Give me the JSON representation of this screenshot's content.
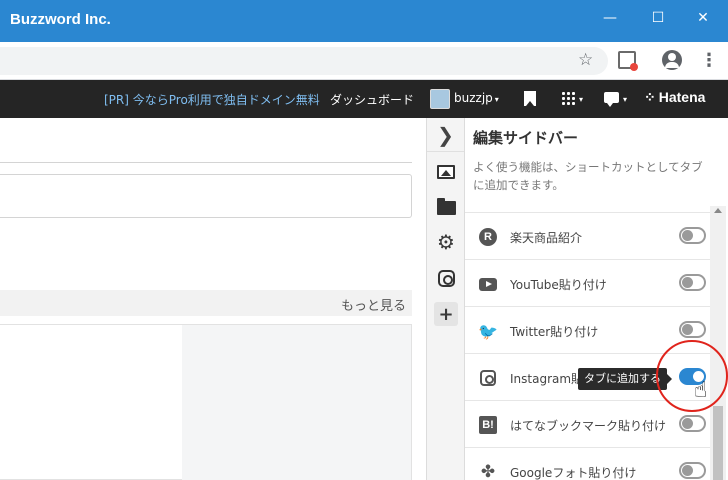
{
  "window": {
    "title": "Buzzword Inc.",
    "minimize_glyph": "—",
    "maximize_glyph": "☐",
    "close_glyph": "✕"
  },
  "browser": {
    "star_glyph": "☆",
    "menu_glyph": "⋮"
  },
  "header": {
    "promo_text": "[PR] 今ならPro利用で独自ドメイン無料",
    "dashboard_label": "ダッシュボード",
    "username": "buzzjp",
    "logo_text": "Hatena",
    "logo_mark": "⁘",
    "caret_glyph": "▾"
  },
  "editor": {
    "more_link": "もっと見る"
  },
  "icon_column": {
    "toggle_glyph": "❯",
    "gear_glyph": "⚙",
    "plus_glyph": "+"
  },
  "panel": {
    "title": "編集サイドバー",
    "description": "よく使う機能は、ショートカットとしてタブに追加できます。",
    "items": [
      {
        "label": "楽天商品紹介",
        "icon": "rakuten-icon",
        "glyph": "R",
        "enabled": false
      },
      {
        "label": "YouTube貼り付け",
        "icon": "youtube-icon",
        "glyph": "",
        "enabled": false
      },
      {
        "label": "Twitter貼り付け",
        "icon": "twitter-icon",
        "glyph": "🐦",
        "enabled": false
      },
      {
        "label": "Instagram貼り付け",
        "icon": "instagram-icon",
        "glyph": "",
        "enabled": true
      },
      {
        "label": "はてなブックマーク貼り付け",
        "icon": "hatena-bookmark-icon",
        "glyph": "B!",
        "enabled": false
      },
      {
        "label": "Googleフォト貼り付け",
        "icon": "google-photos-icon",
        "glyph": "✤",
        "enabled": false
      }
    ]
  },
  "tooltip": {
    "text": "タブに追加する"
  },
  "cursor_glyph": "☝",
  "colors": {
    "titlebar": "#2b87d1",
    "header_bg": "#252525",
    "promo": "#7fbdf0",
    "switch_on": "#2b87d1",
    "highlight": "#e0241c"
  }
}
